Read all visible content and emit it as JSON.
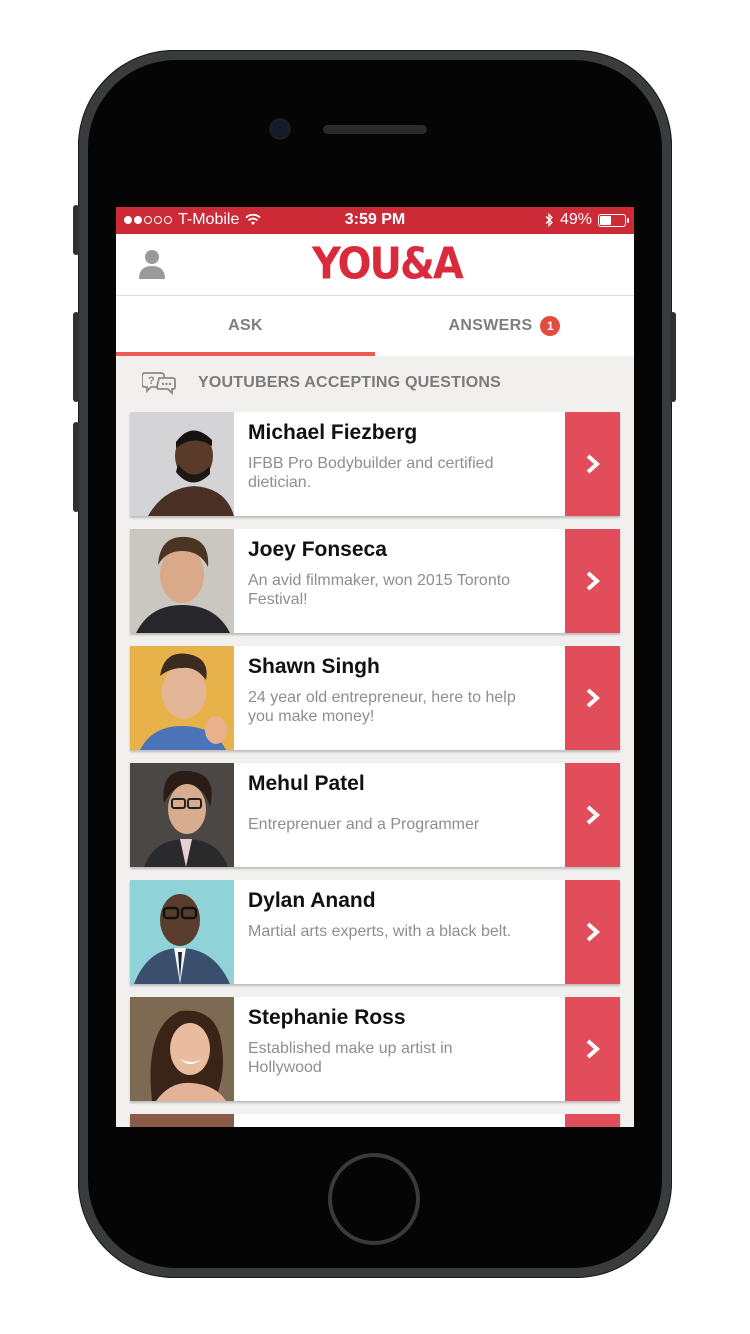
{
  "status_bar": {
    "carrier": "T-Mobile",
    "time": "3:59 PM",
    "battery": "49%",
    "battery_level": 0.49
  },
  "header": {
    "logo": "YOU&A",
    "profile_icon": "user-icon"
  },
  "tabs": [
    {
      "label": "ASK",
      "active": true
    },
    {
      "label": "ANSWERS",
      "badge": "1",
      "active": false
    }
  ],
  "section": {
    "title": "YOUTUBERS ACCEPTING QUESTIONS",
    "icon": "question-chat-icon"
  },
  "youtubers": [
    {
      "name": "Michael Fiezberg",
      "description": "IFBB Pro Bodybuilder and certified dietician."
    },
    {
      "name": "Joey Fonseca",
      "description": "An avid filmmaker, won 2015 Toronto Festival!"
    },
    {
      "name": "Shawn Singh",
      "description": "24 year old entrepreneur, here to help you make money!"
    },
    {
      "name": "Mehul Patel",
      "description": "Entreprenuer and a Programmer"
    },
    {
      "name": "Dylan Anand",
      "description": "Martial arts experts, with a black belt."
    },
    {
      "name": "Stephanie Ross",
      "description": "Established make up artist in Hollywood"
    }
  ],
  "colors": {
    "brand_red": "#cc2a37",
    "accent": "#e14d5a",
    "tab_underline": "#ec5b52"
  }
}
